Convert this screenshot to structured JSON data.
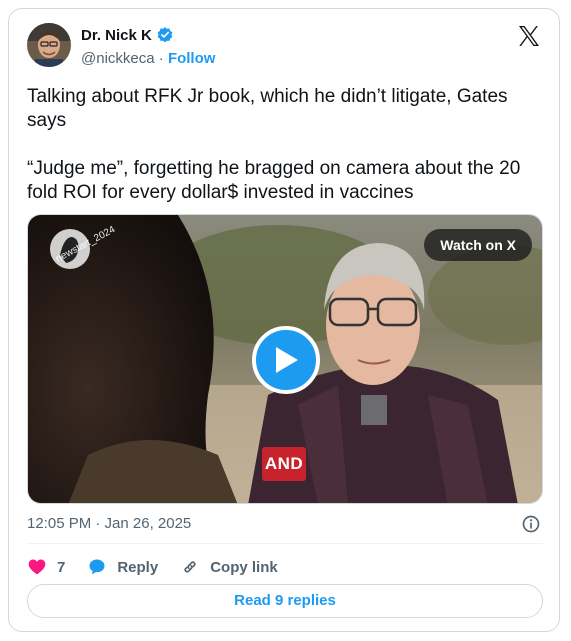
{
  "author": {
    "name": "Dr. Nick K",
    "handle": "@nickkeca",
    "separator": "·",
    "follow_label": "Follow"
  },
  "tweet": {
    "text": "Talking about RFK Jr book, which he didn’t litigate, Gates says\n\n“Judge me”, forgetting he bragged on camera about the 20 fold ROI for every dollar$ invested in vaccines"
  },
  "media": {
    "watch_label": "Watch on X",
    "watermark": "newstart_2024",
    "logo_text": "AND"
  },
  "meta": {
    "timestamp": "12:05 PM · Jan 26, 2025"
  },
  "actions": {
    "likes": "7",
    "reply_label": "Reply",
    "copy_link_label": "Copy link"
  },
  "read_replies_label": "Read 9 replies",
  "colors": {
    "accent": "#1d9bf0",
    "like": "#f91880",
    "text": "#0f1419",
    "muted": "#536471",
    "border": "#cfd9de"
  },
  "icons": [
    "verified-badge-icon",
    "x-logo-icon",
    "play-icon",
    "info-icon",
    "heart-icon",
    "reply-icon",
    "link-icon"
  ]
}
